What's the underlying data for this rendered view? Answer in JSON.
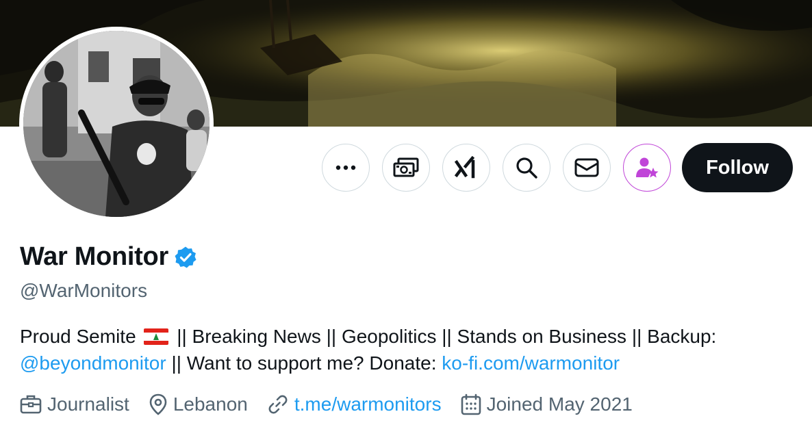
{
  "profile": {
    "display_name": "War Monitor",
    "handle": "@WarMonitors",
    "verified": true,
    "bio": {
      "part1": "Proud Semite",
      "part2": "|| Breaking News || Geopolitics || Stands on Business || Backup:",
      "mention": "@beyondmonitor",
      "part3": "|| Want to support me? Donate:",
      "donate_link": "ko-fi.com/warmonitor"
    },
    "meta": {
      "profession": "Journalist",
      "location": "Lebanon",
      "website": "t.me/warmonitors",
      "joined": "Joined May 2021"
    }
  },
  "actions": {
    "more_icon": "more-dots-icon",
    "tip_icon": "money-icon",
    "grok_icon": "grok-icon",
    "search_icon": "search-icon",
    "message_icon": "envelope-icon",
    "subscribe_icon": "subscribe-person-star-icon",
    "follow_label": "Follow"
  },
  "colors": {
    "link": "#1d9bf0",
    "secondary_text": "#536471",
    "follow_bg": "#0f1419",
    "subscribe_accent": "#c045d8",
    "verified_badge": "#1d9bf0"
  }
}
